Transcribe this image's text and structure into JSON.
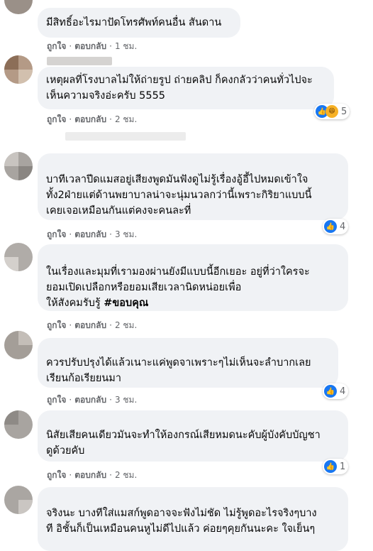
{
  "comments": [
    {
      "text": "มีสิทธิ์อะไรมาปัดโทรศัพท์คนอื่น สันดาน",
      "like": "ถูกใจ",
      "reply": "ตอบกลับ",
      "time": "1 ชม."
    },
    {
      "text": "เหตุผลที่โรงบาลไม่ให้ถ่ายรูป ถ่ายคลิป ก็คงกลัวว่าคนทั่วไปจะ\nเห็นความจริงอ่ะครับ 5555",
      "like": "ถูกใจ",
      "reply": "ตอบกลับ",
      "time": "2 ชม.",
      "reactions": "5"
    },
    {
      "text": "บาทีเวลาปีดแมสอยู่เสียงพูดมันฟังดูไม่รู้เรื่องอู้อี้ไปหมดเข้าใจ\nทั้ง2ฝ่ายแต่ด้านพยาบาลน่าจะนุ่มนวลกว่านี้เพราะกิริยาแบบนี้\nเคยเจอเหมือนกันแต่คงจะคนละที่",
      "like": "ถูกใจ",
      "reply": "ตอบกลับ",
      "time": "3 ชม.",
      "reactions": "4"
    },
    {
      "text_plain": "ในเรื่องและมุมที่เรามองผ่านยังมีแบบนี้อีกเยอะ อยู่ที่ว่าใครจะ\nยอมเปิดเปลือกหรือยอมเสียเวลานิดหน่อยเพื่อ\nให้สังคมรับรู้ ",
      "hashtag": "#ขอบคุณ",
      "like": "ถูกใจ",
      "reply": "ตอบกลับ",
      "time": "2 ชม."
    },
    {
      "text": "ควรปรับปรุงได้แล้วเนาะแค่พูดจาเพราะๆไม่เห็นจะลำบากเลย\nเรียนก้อเรียยนมา",
      "like": "ถูกใจ",
      "reply": "ตอบกลับ",
      "time": "3 ชม.",
      "reactions": "4"
    },
    {
      "text": "นิสัยเสียคนเดียวมันจะทำให้องกรณ์เสียหมดนะคับผู้บังคับบัญชา\nดูด้วยคับ",
      "like": "ถูกใจ",
      "reply": "ตอบกลับ",
      "time": "2 ชม.",
      "reactions": "1"
    },
    {
      "text": "จริงนะ บางทีใส่แมสก์พูดอาจจะฟังไม่ชัด ไม่รู้พูดอะไรจริงๆบาง\nที อิชั้นก็เป็นเหมือนคนหูไม่ดีไปแล้ว ค่อยๆคุยกันนะคะ ใจเย็นๆ"
    }
  ],
  "separator": "·",
  "colors": {
    "bubble": "#f0f2f5",
    "like_blue": "#1877f2",
    "meta": "#65676b"
  },
  "icons": {
    "like": "thumbs-up-icon",
    "haha": "laughing-face-icon"
  }
}
